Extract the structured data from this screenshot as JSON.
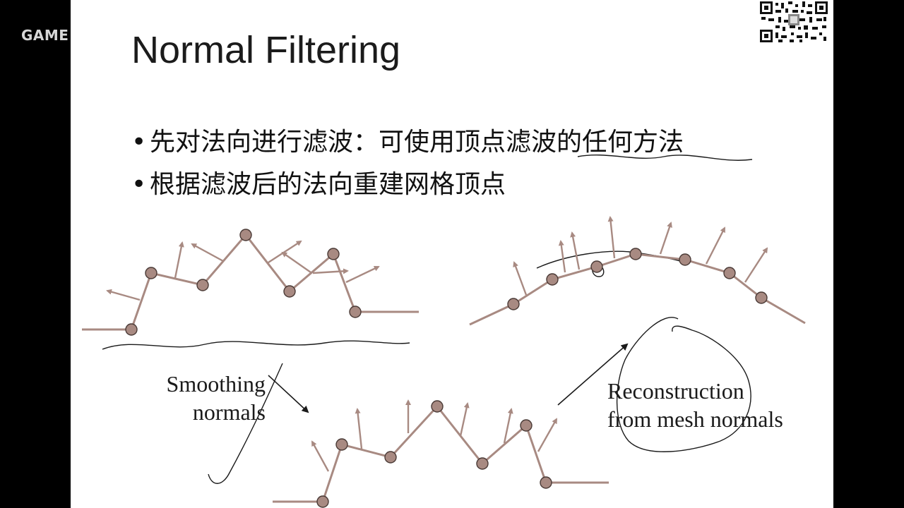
{
  "watermark": "GAME",
  "slide": {
    "title": "Normal Filtering",
    "bullets": [
      "先对法向进行滤波：可使用顶点滤波的任何方法",
      "根据滤波后的法向重建网格顶点"
    ],
    "captions": {
      "smoothing": [
        "Smoothing",
        "normals"
      ],
      "reconstruction": [
        "Reconstruction",
        "from mesh normals"
      ]
    }
  },
  "colors": {
    "mesh": "#a88a82",
    "vertex": "#a88a82",
    "ink": "#1a1a1a",
    "background": "#ffffff",
    "frame": "#000000"
  }
}
